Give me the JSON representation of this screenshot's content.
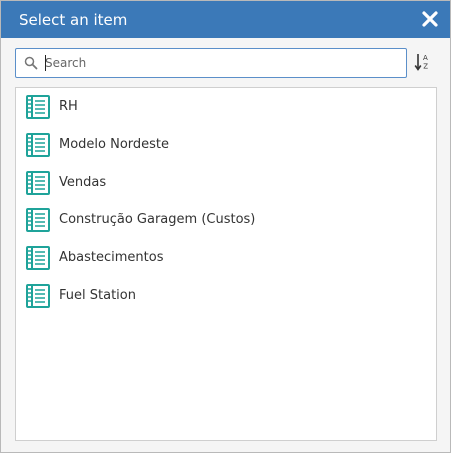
{
  "dialog": {
    "title": "Select an item",
    "close_icon": "close-icon"
  },
  "search": {
    "placeholder": "Search",
    "value": "",
    "icon": "search-icon"
  },
  "sort": {
    "icon": "sort-alpha-icon"
  },
  "colors": {
    "titlebar": "#3b79b8",
    "item_icon": "#1fa39a",
    "search_border": "#5b8fc9"
  },
  "items": [
    {
      "label": "RH",
      "icon": "report-book-icon"
    },
    {
      "label": "Modelo Nordeste",
      "icon": "report-book-icon"
    },
    {
      "label": "Vendas",
      "icon": "report-book-icon"
    },
    {
      "label": "Construção Garagem (Custos)",
      "icon": "report-book-icon"
    },
    {
      "label": "Abastecimentos",
      "icon": "report-book-icon"
    },
    {
      "label": "Fuel Station",
      "icon": "report-book-icon"
    }
  ]
}
